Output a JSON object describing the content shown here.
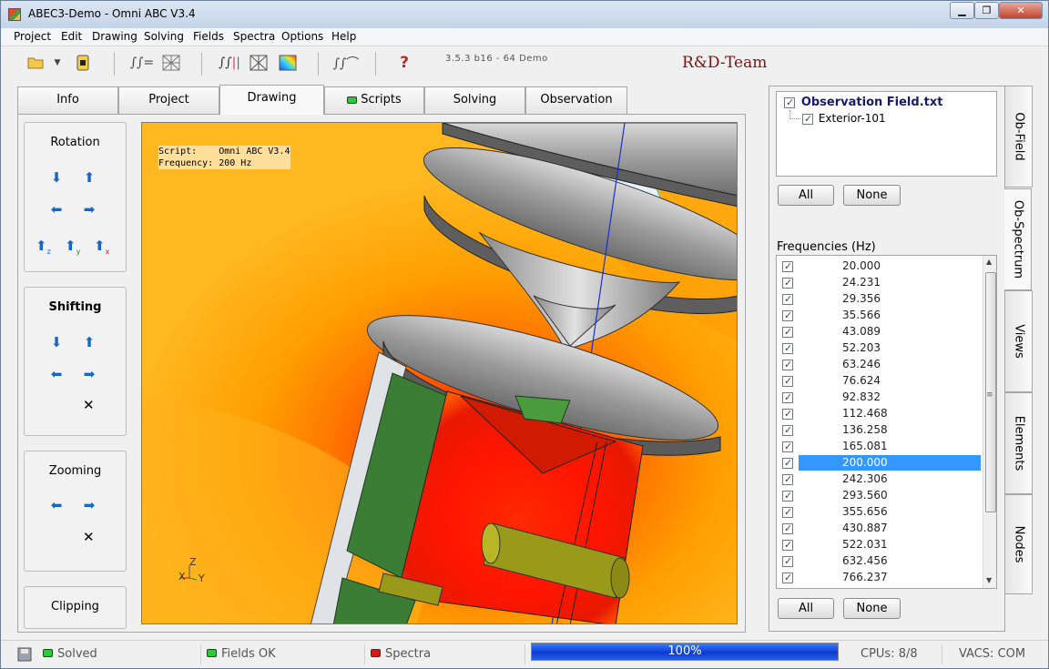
{
  "window": {
    "title": "ABEC3-Demo - Omni ABC V3.4"
  },
  "menu": [
    "Project",
    "Edit",
    "Drawing",
    "Solving",
    "Fields",
    "Spectra",
    "Options",
    "Help"
  ],
  "toolbar": {
    "version": "3.5.3 b16 - 64 Demo",
    "team": "R&D-Team"
  },
  "tabs": {
    "info": "Info",
    "project": "Project",
    "drawing": "Drawing",
    "scripts": "Scripts",
    "solving": "Solving",
    "observation": "Observation"
  },
  "controls": {
    "rotation": "Rotation",
    "shifting": "Shifting",
    "zooming": "Zooming",
    "clipping": "Clipping",
    "axes": {
      "z": "z",
      "y": "y",
      "x": "x"
    }
  },
  "viewport": {
    "script_line": "Script:    Omni ABC V3.4",
    "frequency_line": "Frequency: 200 Hz",
    "axis_z": "Z",
    "axis_x": "X",
    "axis_y": "Y"
  },
  "obfield": {
    "file": "Observation Field.txt",
    "child": "Exterior-101",
    "all_label": "All",
    "none_label": "None"
  },
  "frequencies": {
    "label": "Frequencies  (Hz)",
    "selected": "200.000",
    "items": [
      "20.000",
      "24.231",
      "29.356",
      "35.566",
      "43.089",
      "52.203",
      "63.246",
      "76.624",
      "92.832",
      "112.468",
      "136.258",
      "165.081",
      "200.000",
      "242.306",
      "293.560",
      "355.656",
      "430.887",
      "522.031",
      "632.456",
      "766.237"
    ],
    "all_label": "All",
    "none_label": "None"
  },
  "side_tabs": [
    "Ob-Field",
    "Ob-Spectrum",
    "Views",
    "Elements",
    "Nodes"
  ],
  "status": {
    "solved": "Solved",
    "fields_ok": "Fields OK",
    "spectra": "Spectra",
    "progress_value": 100,
    "progress_text": "100%",
    "cpus": "CPUs: 8/8",
    "vacs": "VACS: COM"
  },
  "colors": {
    "led_green": "#2ec93a",
    "led_red": "#d11a1a",
    "selection": "#3399ff",
    "team": "#7b1313"
  }
}
